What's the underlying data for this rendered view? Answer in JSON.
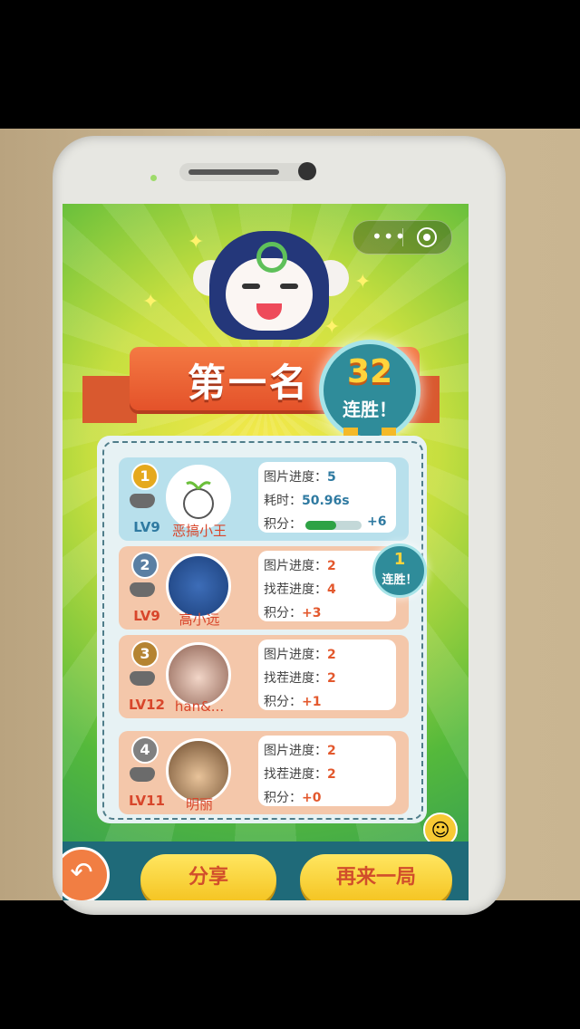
{
  "colors": {
    "ribbon": "#e4522a",
    "medal": "#2f8c9a",
    "button": "#f4c21e",
    "panel": "#e7f2f4"
  },
  "top_capsule": {
    "menu_icon": "more-dots-icon",
    "close_icon": "target-close-icon"
  },
  "result": {
    "title": "第一名",
    "streak_number": "32",
    "streak_label": "连胜！"
  },
  "players": [
    {
      "rank": "1",
      "level": "LV9",
      "name": "恶搞小王",
      "stats": [
        {
          "label": "图片进度：",
          "value": "5"
        },
        {
          "label": "耗时：",
          "value": "50.96s"
        },
        {
          "label": "积分：",
          "value": "+6"
        }
      ],
      "progress": 0.55
    },
    {
      "rank": "2",
      "level": "LV9",
      "name": "高小远",
      "stats": [
        {
          "label": "图片进度：",
          "value": "2"
        },
        {
          "label": "找茬进度：",
          "value": "4"
        },
        {
          "label": "积分：",
          "value": "+3"
        }
      ]
    },
    {
      "rank": "3",
      "level": "LV12",
      "name": "han&...",
      "stats": [
        {
          "label": "图片进度：",
          "value": "2"
        },
        {
          "label": "找茬进度：",
          "value": "2"
        },
        {
          "label": "积分：",
          "value": "+1"
        }
      ]
    },
    {
      "rank": "4",
      "level": "LV11",
      "name": "明丽",
      "stats": [
        {
          "label": "图片进度：",
          "value": "2"
        },
        {
          "label": "找茬进度：",
          "value": "2"
        },
        {
          "label": "积分：",
          "value": "+0"
        }
      ]
    }
  ],
  "small_medal": {
    "number": "1",
    "label": "连胜！"
  },
  "buttons": {
    "share": "分享",
    "again": "再来一局"
  }
}
